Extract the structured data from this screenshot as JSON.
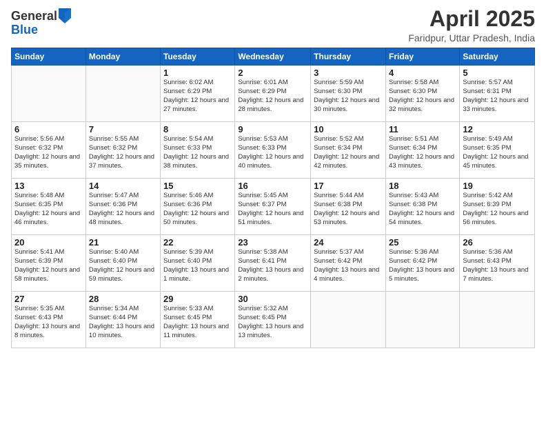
{
  "header": {
    "logo_general": "General",
    "logo_blue": "Blue",
    "title": "April 2025",
    "location": "Faridpur, Uttar Pradesh, India"
  },
  "days_of_week": [
    "Sunday",
    "Monday",
    "Tuesday",
    "Wednesday",
    "Thursday",
    "Friday",
    "Saturday"
  ],
  "weeks": [
    [
      {
        "day": "",
        "info": ""
      },
      {
        "day": "",
        "info": ""
      },
      {
        "day": "1",
        "info": "Sunrise: 6:02 AM\nSunset: 6:29 PM\nDaylight: 12 hours and 27 minutes."
      },
      {
        "day": "2",
        "info": "Sunrise: 6:01 AM\nSunset: 6:29 PM\nDaylight: 12 hours and 28 minutes."
      },
      {
        "day": "3",
        "info": "Sunrise: 5:59 AM\nSunset: 6:30 PM\nDaylight: 12 hours and 30 minutes."
      },
      {
        "day": "4",
        "info": "Sunrise: 5:58 AM\nSunset: 6:30 PM\nDaylight: 12 hours and 32 minutes."
      },
      {
        "day": "5",
        "info": "Sunrise: 5:57 AM\nSunset: 6:31 PM\nDaylight: 12 hours and 33 minutes."
      }
    ],
    [
      {
        "day": "6",
        "info": "Sunrise: 5:56 AM\nSunset: 6:32 PM\nDaylight: 12 hours and 35 minutes."
      },
      {
        "day": "7",
        "info": "Sunrise: 5:55 AM\nSunset: 6:32 PM\nDaylight: 12 hours and 37 minutes."
      },
      {
        "day": "8",
        "info": "Sunrise: 5:54 AM\nSunset: 6:33 PM\nDaylight: 12 hours and 38 minutes."
      },
      {
        "day": "9",
        "info": "Sunrise: 5:53 AM\nSunset: 6:33 PM\nDaylight: 12 hours and 40 minutes."
      },
      {
        "day": "10",
        "info": "Sunrise: 5:52 AM\nSunset: 6:34 PM\nDaylight: 12 hours and 42 minutes."
      },
      {
        "day": "11",
        "info": "Sunrise: 5:51 AM\nSunset: 6:34 PM\nDaylight: 12 hours and 43 minutes."
      },
      {
        "day": "12",
        "info": "Sunrise: 5:49 AM\nSunset: 6:35 PM\nDaylight: 12 hours and 45 minutes."
      }
    ],
    [
      {
        "day": "13",
        "info": "Sunrise: 5:48 AM\nSunset: 6:35 PM\nDaylight: 12 hours and 46 minutes."
      },
      {
        "day": "14",
        "info": "Sunrise: 5:47 AM\nSunset: 6:36 PM\nDaylight: 12 hours and 48 minutes."
      },
      {
        "day": "15",
        "info": "Sunrise: 5:46 AM\nSunset: 6:36 PM\nDaylight: 12 hours and 50 minutes."
      },
      {
        "day": "16",
        "info": "Sunrise: 5:45 AM\nSunset: 6:37 PM\nDaylight: 12 hours and 51 minutes."
      },
      {
        "day": "17",
        "info": "Sunrise: 5:44 AM\nSunset: 6:38 PM\nDaylight: 12 hours and 53 minutes."
      },
      {
        "day": "18",
        "info": "Sunrise: 5:43 AM\nSunset: 6:38 PM\nDaylight: 12 hours and 54 minutes."
      },
      {
        "day": "19",
        "info": "Sunrise: 5:42 AM\nSunset: 6:39 PM\nDaylight: 12 hours and 56 minutes."
      }
    ],
    [
      {
        "day": "20",
        "info": "Sunrise: 5:41 AM\nSunset: 6:39 PM\nDaylight: 12 hours and 58 minutes."
      },
      {
        "day": "21",
        "info": "Sunrise: 5:40 AM\nSunset: 6:40 PM\nDaylight: 12 hours and 59 minutes."
      },
      {
        "day": "22",
        "info": "Sunrise: 5:39 AM\nSunset: 6:40 PM\nDaylight: 13 hours and 1 minute."
      },
      {
        "day": "23",
        "info": "Sunrise: 5:38 AM\nSunset: 6:41 PM\nDaylight: 13 hours and 2 minutes."
      },
      {
        "day": "24",
        "info": "Sunrise: 5:37 AM\nSunset: 6:42 PM\nDaylight: 13 hours and 4 minutes."
      },
      {
        "day": "25",
        "info": "Sunrise: 5:36 AM\nSunset: 6:42 PM\nDaylight: 13 hours and 5 minutes."
      },
      {
        "day": "26",
        "info": "Sunrise: 5:36 AM\nSunset: 6:43 PM\nDaylight: 13 hours and 7 minutes."
      }
    ],
    [
      {
        "day": "27",
        "info": "Sunrise: 5:35 AM\nSunset: 6:43 PM\nDaylight: 13 hours and 8 minutes."
      },
      {
        "day": "28",
        "info": "Sunrise: 5:34 AM\nSunset: 6:44 PM\nDaylight: 13 hours and 10 minutes."
      },
      {
        "day": "29",
        "info": "Sunrise: 5:33 AM\nSunset: 6:45 PM\nDaylight: 13 hours and 11 minutes."
      },
      {
        "day": "30",
        "info": "Sunrise: 5:32 AM\nSunset: 6:45 PM\nDaylight: 13 hours and 13 minutes."
      },
      {
        "day": "",
        "info": ""
      },
      {
        "day": "",
        "info": ""
      },
      {
        "day": "",
        "info": ""
      }
    ]
  ]
}
